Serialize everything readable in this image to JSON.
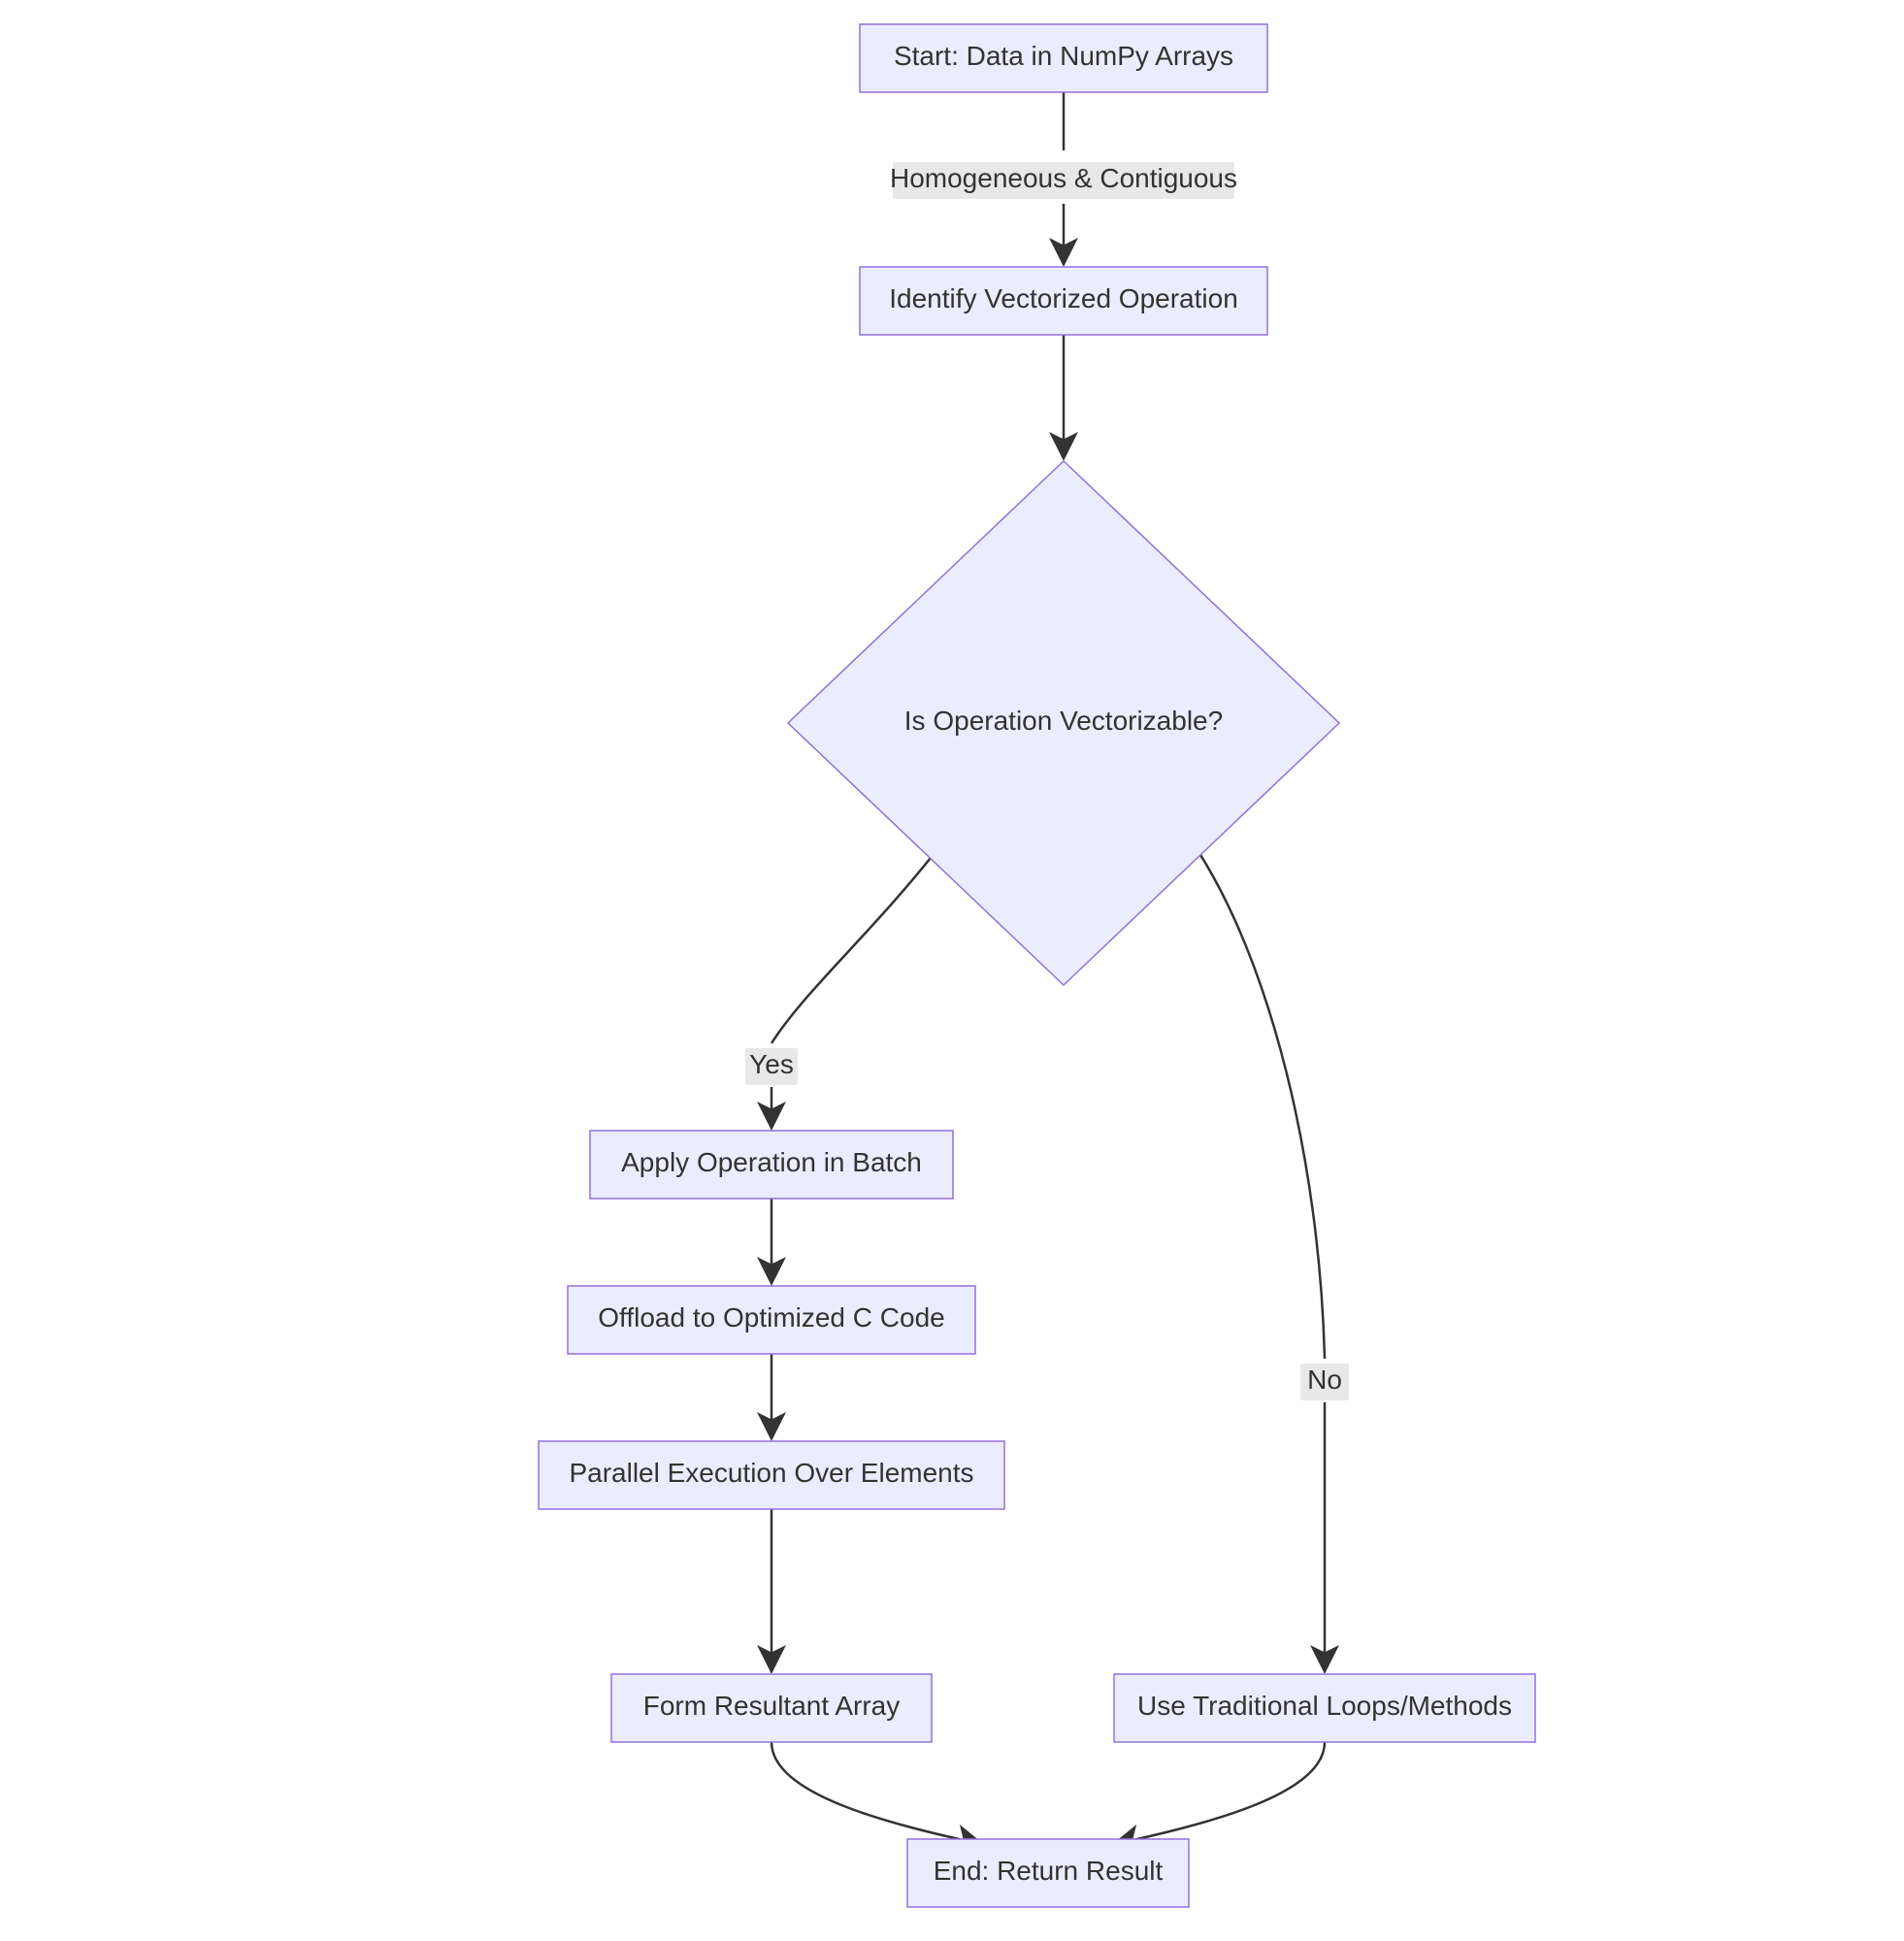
{
  "chart_data": {
    "type": "flowchart",
    "nodes": {
      "A": {
        "label": "Start: Data in NumPy Arrays",
        "shape": "rect"
      },
      "B": {
        "label": "Identify Vectorized Operation",
        "shape": "rect"
      },
      "C": {
        "label": "Is Operation Vectorizable?",
        "shape": "diamond"
      },
      "D": {
        "label": "Apply Operation in Batch",
        "shape": "rect"
      },
      "E": {
        "label": "Offload to Optimized C Code",
        "shape": "rect"
      },
      "F": {
        "label": "Parallel Execution Over Elements",
        "shape": "rect"
      },
      "G": {
        "label": "Form Resultant Array",
        "shape": "rect"
      },
      "H": {
        "label": "Use Traditional Loops/Methods",
        "shape": "rect"
      },
      "I": {
        "label": "End: Return Result",
        "shape": "rect"
      }
    },
    "edges": [
      {
        "from": "A",
        "to": "B",
        "label": "Homogeneous & Contiguous"
      },
      {
        "from": "B",
        "to": "C",
        "label": ""
      },
      {
        "from": "C",
        "to": "D",
        "label": "Yes"
      },
      {
        "from": "C",
        "to": "H",
        "label": "No"
      },
      {
        "from": "D",
        "to": "E",
        "label": ""
      },
      {
        "from": "E",
        "to": "F",
        "label": ""
      },
      {
        "from": "F",
        "to": "G",
        "label": ""
      },
      {
        "from": "G",
        "to": "I",
        "label": ""
      },
      {
        "from": "H",
        "to": "I",
        "label": ""
      }
    ]
  },
  "colors": {
    "node_fill": "#ECECFF",
    "node_stroke": "#9370DB",
    "edge_stroke": "#333333",
    "label_bg": "#e8e8e8",
    "text": "#333333"
  }
}
